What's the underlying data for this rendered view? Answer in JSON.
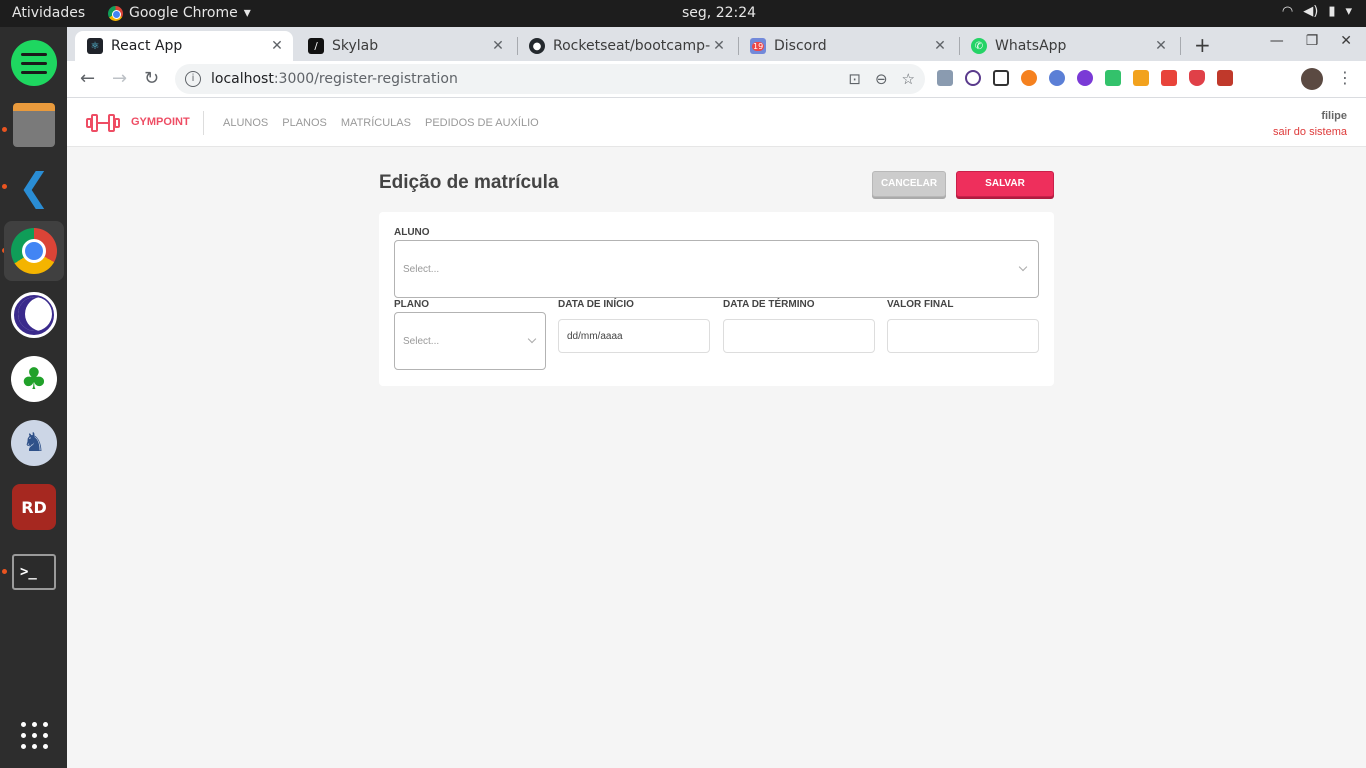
{
  "system": {
    "activities": "Atividades",
    "app_menu": "Google Chrome",
    "clock": "seg, 22:24"
  },
  "tabs": [
    {
      "title": "React App",
      "icon": "react-icon"
    },
    {
      "title": "Skylab",
      "icon": "skylab-icon"
    },
    {
      "title": "Rocketseat/bootcamp-",
      "icon": "github-icon"
    },
    {
      "title": "Discord",
      "icon": "discord-icon",
      "badge": "19"
    },
    {
      "title": "WhatsApp",
      "icon": "whatsapp-icon"
    }
  ],
  "address": {
    "host": "localhost",
    "path": ":3000/register-registration"
  },
  "app": {
    "brand": "GYMPOINT",
    "nav": [
      "ALUNOS",
      "PLANOS",
      "MATRÍCULAS",
      "PEDIDOS DE AUXÍLIO"
    ],
    "user_name": "filipe",
    "logout": "sair do sistema"
  },
  "form": {
    "title": "Edição de matrícula",
    "cancel": "CANCELAR",
    "save": "SALVAR",
    "student_label": "ALUNO",
    "student_placeholder": "Select...",
    "plan_label": "PLANO",
    "plan_placeholder": "Select...",
    "start_label": "DATA DE INÍCIO",
    "start_value": "dd/mm/aaaa",
    "end_label": "DATA DE TÉRMINO",
    "end_value": "",
    "price_label": "VALOR FINAL",
    "price_value": ""
  },
  "colors": {
    "brand": "#ee4d64",
    "save_button": "#ee2f5c",
    "cancel_button": "#cccccc",
    "logout": "#de3b3b"
  }
}
